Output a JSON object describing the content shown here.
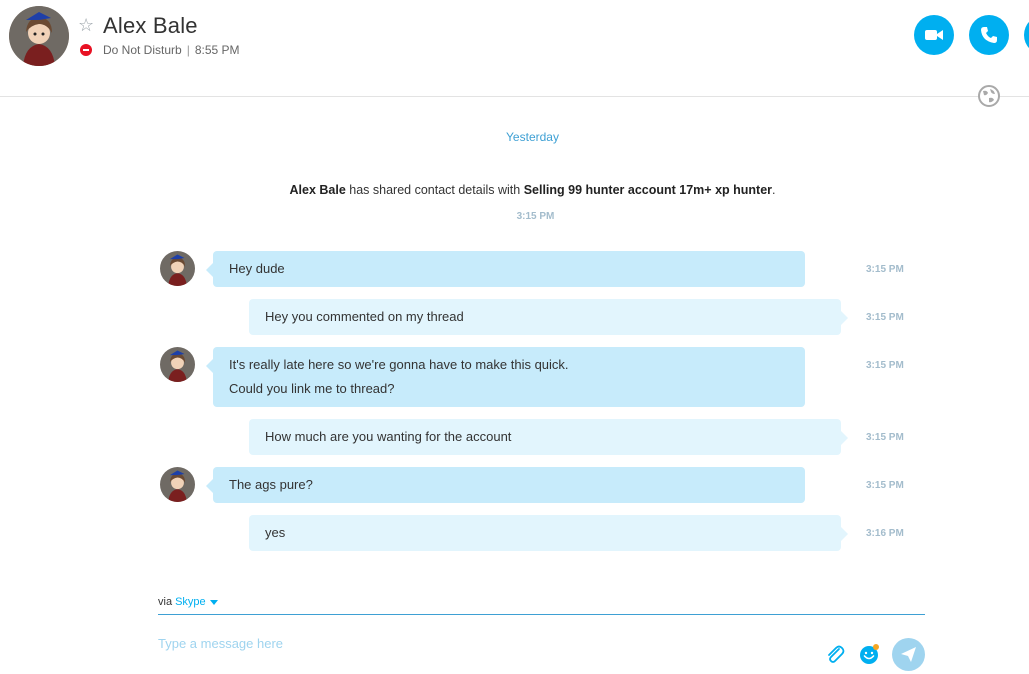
{
  "header": {
    "contact_name": "Alex Bale",
    "status": "Do Not Disturb",
    "separator": "|",
    "local_time": "8:55 PM"
  },
  "conversation": {
    "day_separator": "Yesterday",
    "share_event": {
      "sender": "Alex Bale",
      "text": "has shared contact details with",
      "target": "Selling 99 hunter account 17m+ xp hunter",
      "end": ".",
      "time": "3:15 PM"
    },
    "messages": [
      {
        "direction": "in",
        "lines": [
          "Hey dude"
        ],
        "time": "3:15 PM"
      },
      {
        "direction": "out",
        "lines": [
          "Hey you commented on my thread"
        ],
        "time": "3:15 PM"
      },
      {
        "direction": "in",
        "lines": [
          "It's really late here so we're gonna have to make this quick.",
          "Could you link me to thread?"
        ],
        "time": "3:15 PM"
      },
      {
        "direction": "out",
        "lines": [
          "How much are you wanting for the account"
        ],
        "time": "3:15 PM"
      },
      {
        "direction": "in",
        "lines": [
          "The ags pure?"
        ],
        "time": "3:15 PM"
      },
      {
        "direction": "out",
        "lines": [
          "yes"
        ],
        "time": "3:16 PM"
      }
    ]
  },
  "composer": {
    "via_label": "via",
    "service": "Skype",
    "placeholder": "Type a message here"
  },
  "colors": {
    "accent": "#00aff0",
    "incoming_bubble": "#c7ebfb",
    "outgoing_bubble": "#e2f5fd",
    "dnd": "#e81123"
  }
}
